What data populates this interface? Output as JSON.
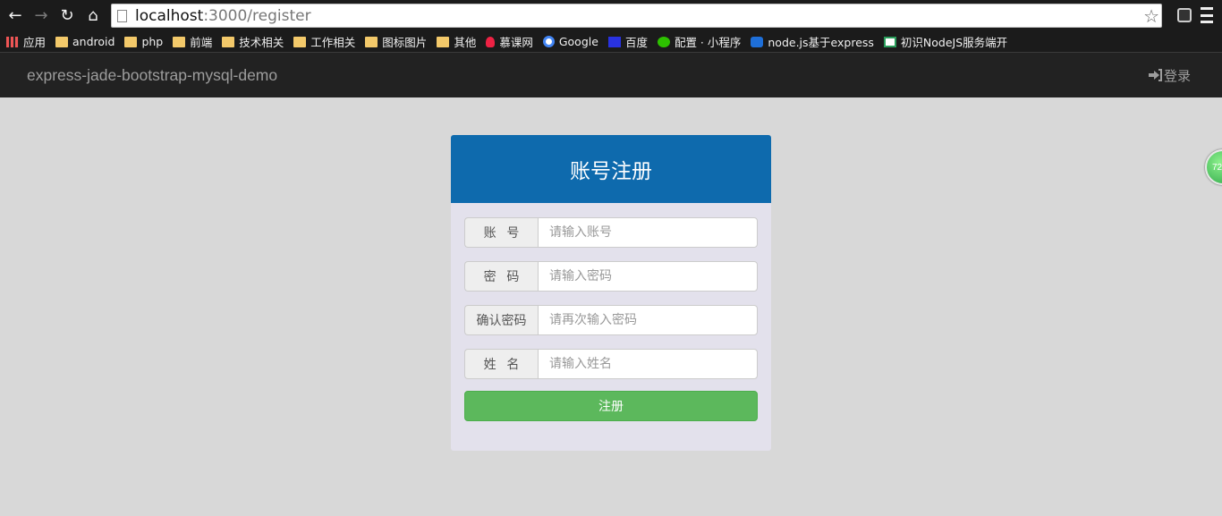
{
  "browser": {
    "url_host": "localhost",
    "url_path": ":3000/register",
    "bookmarks": [
      {
        "label": "应用",
        "icon": "apps-icon"
      },
      {
        "label": "android",
        "icon": "folder-icon"
      },
      {
        "label": "php",
        "icon": "folder-icon"
      },
      {
        "label": "前端",
        "icon": "folder-icon"
      },
      {
        "label": "技术相关",
        "icon": "folder-icon"
      },
      {
        "label": "工作相关",
        "icon": "folder-icon"
      },
      {
        "label": "图标图片",
        "icon": "folder-icon"
      },
      {
        "label": "其他",
        "icon": "folder-icon"
      },
      {
        "label": "慕课网",
        "icon": "fire-icon"
      },
      {
        "label": "Google",
        "icon": "google-icon"
      },
      {
        "label": "百度",
        "icon": "baidu-icon"
      },
      {
        "label": "配置 · 小程序",
        "icon": "wechat-icon"
      },
      {
        "label": "node.js基于express",
        "icon": "site-icon"
      },
      {
        "label": "初识NodeJS服务端开",
        "icon": "site-icon"
      }
    ]
  },
  "navbar": {
    "brand": "express-jade-bootstrap-mysql-demo",
    "login_label": "登录"
  },
  "register": {
    "title": "账号注册",
    "fields": [
      {
        "label": "账   号",
        "placeholder": "请输入账号"
      },
      {
        "label": "密   码",
        "placeholder": "请输入密码"
      },
      {
        "label": "确认密码",
        "placeholder": "请再次输入密码"
      },
      {
        "label": "姓   名",
        "placeholder": "请输入姓名"
      }
    ],
    "submit_label": "注册"
  },
  "float_ball": {
    "text": "72"
  },
  "colors": {
    "panel_header": "#0e6aad",
    "submit_button": "#5cb85c",
    "navbar": "#222222",
    "page_background": "#d8d8d8"
  }
}
